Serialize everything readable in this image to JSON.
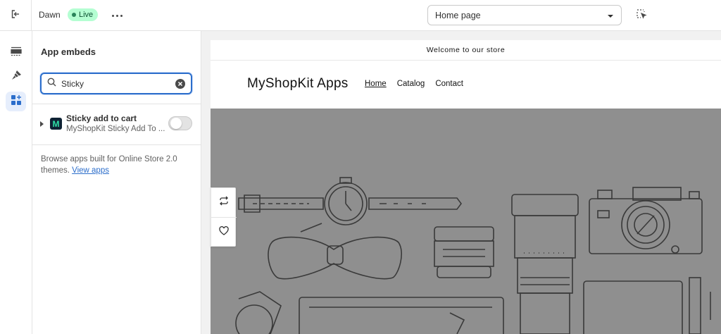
{
  "topbar": {
    "theme_name": "Dawn",
    "live_badge": "Live",
    "page_selector": "Home page"
  },
  "panel": {
    "title": "App embeds",
    "search_value": "Sticky",
    "embed": {
      "title": "Sticky add to cart",
      "subtitle": "MyShopKit Sticky Add To ...",
      "logo_letter": "M",
      "enabled": false
    },
    "browse_text": "Browse apps built for Online Store 2.0 themes.",
    "browse_link": "View apps"
  },
  "preview": {
    "announcement": "Welcome to our store",
    "store_name": "MyShopKit Apps",
    "nav": [
      "Home",
      "Catalog",
      "Contact"
    ]
  },
  "icons": {
    "exit": "exit-icon",
    "sections": "sections-icon",
    "theme_settings": "paintbrush-icon",
    "app_embeds": "app-embeds-icon",
    "search": "search-icon",
    "clear": "clear-icon",
    "inspect": "inspector-icon",
    "swap": "swap-icon",
    "heart": "heart-icon"
  },
  "colors": {
    "accent": "#2c6ecb",
    "live_bg": "#b4fed2",
    "hero_bg": "#8f8f8f"
  }
}
